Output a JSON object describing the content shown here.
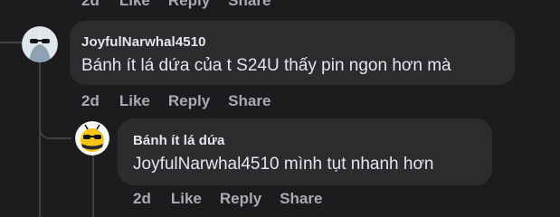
{
  "top_actions": {
    "time": "2d",
    "like": "Like",
    "reply": "Reply",
    "share": "Share"
  },
  "comment1": {
    "author": "JoyfulNarwhal4510",
    "text": "Bánh ít lá dứa của t S24U thấy pin ngon hơn mà",
    "actions": {
      "time": "2d",
      "like": "Like",
      "reply": "Reply",
      "share": "Share"
    }
  },
  "comment2": {
    "author": "Bánh ít lá dứa",
    "text": "JoyfulNarwhal4510 mình tụt nhanh hơn",
    "actions": {
      "time": "2d",
      "like": "Like",
      "reply": "Reply",
      "share": "Share"
    }
  },
  "colors": {
    "background": "#1c1c1e",
    "bubble": "#2c2c2e",
    "muted": "#a8abb1"
  }
}
